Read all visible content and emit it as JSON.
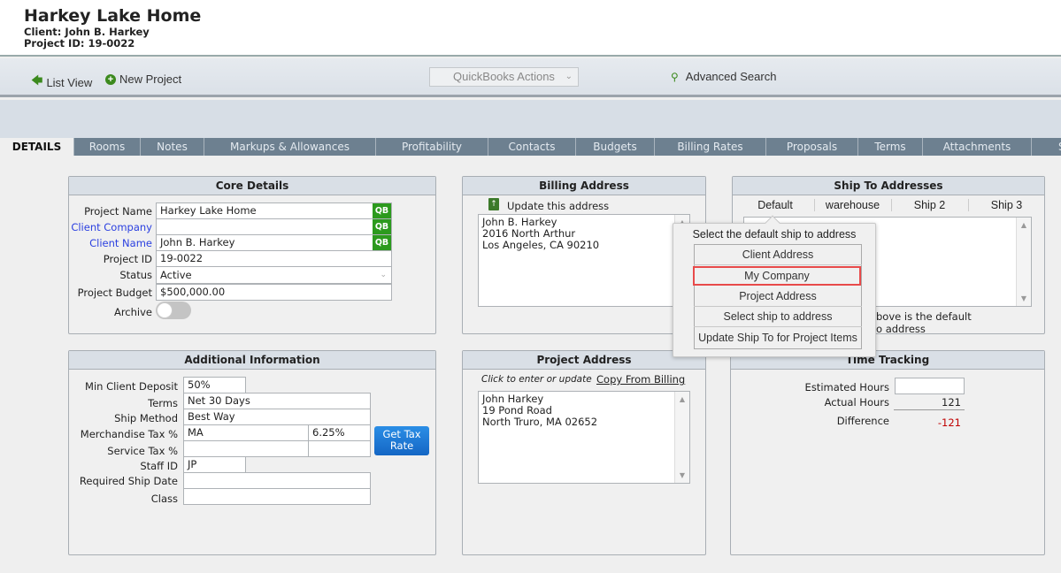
{
  "header": {
    "title": "Harkey Lake Home",
    "client": "Client: John B. Harkey",
    "project_id": "Project ID: 19-0022"
  },
  "toolbar": {
    "list_view": "List View",
    "new_project": "New Project",
    "quickbooks_actions": "QuickBooks Actions",
    "advanced_search": "Advanced Search"
  },
  "tabs": [
    "DETAILS",
    "Rooms",
    "Notes",
    "Markups & Allowances",
    "Profitability",
    "Contacts",
    "Budgets",
    "Billing Rates",
    "Proposals",
    "Terms",
    "Attachments",
    "S"
  ],
  "core": {
    "title": "Core Details",
    "project_name_label": "Project Name",
    "project_name": "Harkey Lake Home",
    "client_company_label": "Client Company",
    "client_company": "",
    "client_name_label": "Client Name",
    "client_name": "John B. Harkey",
    "project_id_label": "Project ID",
    "project_id": "19-0022",
    "status_label": "Status",
    "status": "Active",
    "budget_label": "Project Budget",
    "budget": "$500,000.00",
    "archive_label": "Archive",
    "archive_on": false,
    "qb": "QB"
  },
  "additional": {
    "title": "Additional Information",
    "min_deposit_label": "Min Client Deposit",
    "min_deposit": "50%",
    "terms_label": "Terms",
    "terms": "Net 30 Days",
    "ship_method_label": "Ship Method",
    "ship_method": "Best Way",
    "merch_tax_label": "Merchandise Tax %",
    "merch_tax_state": "MA",
    "merch_tax_rate": "6.25%",
    "service_tax_label": "Service Tax %",
    "service_tax_state": "",
    "service_tax_rate": "",
    "staff_id_label": "Staff ID",
    "staff_id": "JP",
    "ship_date_label": "Required Ship Date",
    "ship_date": "",
    "class_label": "Class",
    "class": "",
    "get_tax_rate": "Get Tax Rate"
  },
  "billing": {
    "title": "Billing Address",
    "update": "Update this address",
    "lines": [
      "John B. Harkey",
      "2016 North Arthur",
      "Los Angeles, CA 90210"
    ]
  },
  "project_address": {
    "title": "Project Address",
    "hint": "Click to enter or update",
    "copy": "Copy From Billing",
    "lines": [
      "John Harkey",
      "19 Pond Road",
      "North Truro, MA 02652"
    ]
  },
  "ship_to": {
    "title": "Ship To Addresses",
    "tabs": [
      "Default",
      "warehouse",
      "Ship 2",
      "Ship 3"
    ],
    "note_line1": "bove is the default",
    "note_line2": "o address"
  },
  "popup": {
    "title": "Select the  default ship to address",
    "options": [
      "Client Address",
      "My Company",
      "Project Address",
      "Select ship to address",
      "Update Ship To for Project Items"
    ],
    "highlighted": "My Company",
    "highlight_color": "#e84a4a"
  },
  "time": {
    "title": "Time Tracking",
    "estimated_label": "Estimated Hours",
    "estimated": "",
    "actual_label": "Actual Hours",
    "actual": "121",
    "difference_label": "Difference",
    "difference": "-121",
    "negative_color": "#c00000"
  }
}
